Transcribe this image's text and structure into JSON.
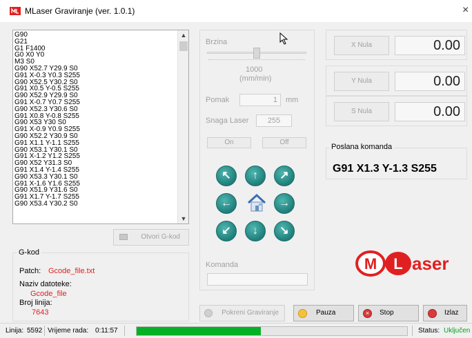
{
  "window": {
    "title": "MLaser Graviranje (ver. 1.0.1)",
    "close_glyph": "×"
  },
  "gcode_lines": [
    "G90",
    "G21",
    "G1 F1400",
    "G0 X0 Y0",
    "M3 S0",
    "G90 X52.7 Y29.9 S0",
    "G91 X-0.3 Y0.3 S255",
    "G90 X52.5 Y30.2 S0",
    "G91 X0.5 Y-0.5 S255",
    "G90 X52.9 Y29.9 S0",
    "G91 X-0.7 Y0.7 S255",
    "G90 X52.3 Y30.6 S0",
    "G91 X0.8 Y-0.8 S255",
    "G90 X53 Y30 S0",
    "G91 X-0.9 Y0.9 S255",
    "G90 X52.2 Y30.9 S0",
    "G91 X1.1 Y-1.1 S255",
    "G90 X53.1 Y30.1 S0",
    "G91 X-1.2 Y1.2 S255",
    "G90 X52 Y31.3 S0",
    "G91 X1.4 Y-1.4 S255",
    "G90 X53.3 Y30.1 S0",
    "G91 X-1.6 Y1.6 S255",
    "G90 X51.9 Y31.6 S0",
    "G91 X1.7 Y-1.7 S255",
    "G90 X53.4 Y30.2 S0"
  ],
  "open_gcode_button": "Otvori G-kod",
  "gkod_group": {
    "legend": "G-kod",
    "patch_label": "Patch:",
    "patch_value": "Gcode_file.txt",
    "naziv_label": "Naziv datoteke:",
    "naziv_value": "Gcode_file",
    "broj_label": "Broj linija:",
    "broj_value": "7643"
  },
  "controls": {
    "brzina_label": "Brzina",
    "speed_value": "1000",
    "speed_unit": "(mm/min)",
    "speed_fraction": 0.5,
    "pomak_label": "Pomak",
    "pomak_value": "1",
    "pomak_unit": "mm",
    "snaga_label": "Snaga Laser",
    "snaga_value": "255",
    "on_label": "On",
    "off_label": "Off",
    "komanda_label": "Komanda",
    "komanda_value": ""
  },
  "axes": [
    {
      "button": "X Nula",
      "value": "0.00"
    },
    {
      "button": "Y Nula",
      "value": "0.00"
    },
    {
      "button": "S Nula",
      "value": "0.00"
    }
  ],
  "poslana": {
    "legend": "Poslana komanda",
    "value": "G91 X1.3 Y-1.3 S255"
  },
  "logo": {
    "m": "M",
    "l": "L",
    "rest": "aser"
  },
  "bottom_buttons": {
    "start": "Pokreni Graviranje",
    "pause": "Pauza",
    "stop": "Stop",
    "exit": "Izlaz"
  },
  "statusbar": {
    "linija_label": "Linija:",
    "linija_value": "5592",
    "vrijeme_label": "Vrijeme rada:",
    "vrijeme_value": "0:11:57",
    "progress_fraction": 0.46,
    "status_label": "Status:",
    "status_value": "Uključen"
  },
  "colors": {
    "accent_red": "#e02020",
    "teal": "#1f7f7a",
    "progress_green": "#06b025"
  }
}
